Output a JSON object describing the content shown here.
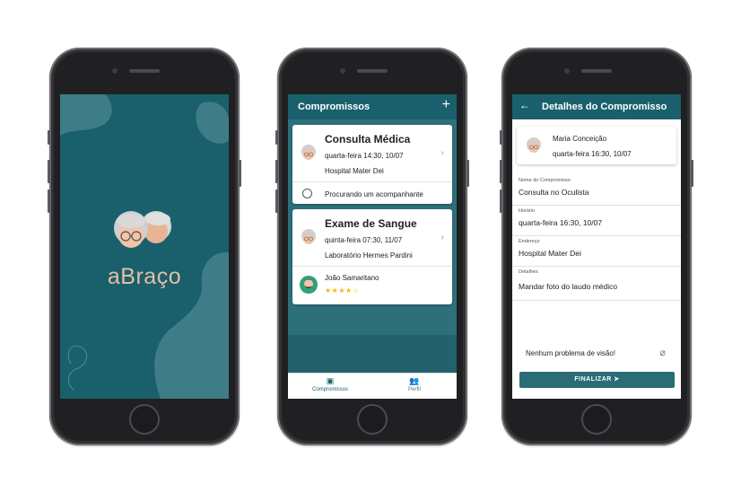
{
  "splash": {
    "logo_text": "aBraço"
  },
  "list": {
    "title": "Compromissos",
    "add_label": "+",
    "cards": [
      {
        "title": "Consulta Médica",
        "datetime": "quarta-feira 14:30, 10/07",
        "place": "Hospital Mater Dei",
        "companion": "Procurando um acompanhante"
      },
      {
        "title": "Exame de Sangue",
        "datetime": "quinta-feira 07:30, 11/07",
        "place": "Laboratório Hermes Pardini",
        "companion": "João Samaritano",
        "stars": "★★★★☆",
        "rating": 4
      }
    ],
    "chevron": "›",
    "nav": {
      "compromissos": "Compromissos",
      "perfil": "Perfil"
    }
  },
  "details": {
    "title": "Detalhes do Compromisso",
    "back": "←",
    "user_name": "Maria Conceição",
    "user_time": "quarta-feira 16:30, 10/07",
    "fields": [
      {
        "label": "Nome do Compromisso",
        "value": "Consulta no Oculista"
      },
      {
        "label": "Horário",
        "value": "quarta-feira 16:30, 10/07"
      },
      {
        "label": "Endereço",
        "value": "Hospital Mater Dei"
      },
      {
        "label": "Detalhes",
        "value": "Mandar foto do laudo médico"
      }
    ],
    "note": "Nenhum problema de visão!",
    "finalize": "FINALIZAR ➤"
  },
  "colors": {
    "brand": "#19606c",
    "list_bg": "#2d6f7a",
    "logo": "#e5bfa6",
    "stars": "#f3b90e"
  }
}
